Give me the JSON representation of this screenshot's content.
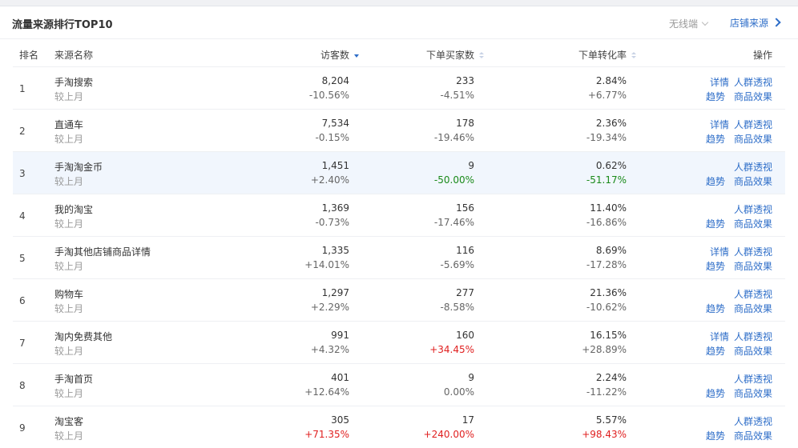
{
  "header": {
    "title": "流量来源排行TOP10",
    "device": "无线端",
    "shop_source": "店铺来源"
  },
  "columns": {
    "rank": "排名",
    "source": "来源名称",
    "visitors": "访客数",
    "buyers": "下单买家数",
    "conversion": "下单转化率",
    "actions": "操作"
  },
  "labels": {
    "compare": "较上月",
    "detail": "详情",
    "crowd": "人群透视",
    "trend": "趋势",
    "goods": "商品效果"
  },
  "colors": {
    "link": "#2d6dc8",
    "increase": "#e02020",
    "decrease": "#1a8a1a",
    "highlight_row": "#f1f6fd"
  },
  "rows": [
    {
      "rank": "1",
      "source": "手淘搜索",
      "visitors": "8,204",
      "visitors_chg": "-10.56%",
      "buyers": "233",
      "buyers_chg": "-4.51%",
      "conv": "2.84%",
      "conv_chg": "+6.77%",
      "has_detail": true
    },
    {
      "rank": "2",
      "source": "直通车",
      "visitors": "7,534",
      "visitors_chg": "-0.15%",
      "buyers": "178",
      "buyers_chg": "-19.46%",
      "conv": "2.36%",
      "conv_chg": "-19.34%",
      "has_detail": true
    },
    {
      "rank": "3",
      "source": "手淘淘金币",
      "visitors": "1,451",
      "visitors_chg": "+2.40%",
      "buyers": "9",
      "buyers_chg": "-50.00%",
      "buyers_chg_color": "green",
      "conv": "0.62%",
      "conv_chg": "-51.17%",
      "conv_chg_color": "green",
      "has_detail": false,
      "highlight": true
    },
    {
      "rank": "4",
      "source": "我的淘宝",
      "visitors": "1,369",
      "visitors_chg": "-0.73%",
      "buyers": "156",
      "buyers_chg": "-17.46%",
      "conv": "11.40%",
      "conv_chg": "-16.86%",
      "has_detail": false
    },
    {
      "rank": "5",
      "source": "手淘其他店铺商品详情",
      "visitors": "1,335",
      "visitors_chg": "+14.01%",
      "buyers": "116",
      "buyers_chg": "-5.69%",
      "conv": "8.69%",
      "conv_chg": "-17.28%",
      "has_detail": true
    },
    {
      "rank": "6",
      "source": "购物车",
      "visitors": "1,297",
      "visitors_chg": "+2.29%",
      "buyers": "277",
      "buyers_chg": "-8.58%",
      "conv": "21.36%",
      "conv_chg": "-10.62%",
      "has_detail": false
    },
    {
      "rank": "7",
      "source": "淘内免费其他",
      "visitors": "991",
      "visitors_chg": "+4.32%",
      "buyers": "160",
      "buyers_chg": "+34.45%",
      "buyers_chg_color": "red",
      "conv": "16.15%",
      "conv_chg": "+28.89%",
      "has_detail": true
    },
    {
      "rank": "8",
      "source": "手淘首页",
      "visitors": "401",
      "visitors_chg": "+12.64%",
      "buyers": "9",
      "buyers_chg": "0.00%",
      "conv": "2.24%",
      "conv_chg": "-11.22%",
      "has_detail": false
    },
    {
      "rank": "9",
      "source": "淘宝客",
      "visitors": "305",
      "visitors_chg": "+71.35%",
      "visitors_chg_color": "red",
      "buyers": "17",
      "buyers_chg": "+240.00%",
      "buyers_chg_color": "red",
      "conv": "5.57%",
      "conv_chg": "+98.43%",
      "conv_chg_color": "red",
      "has_detail": false
    }
  ]
}
